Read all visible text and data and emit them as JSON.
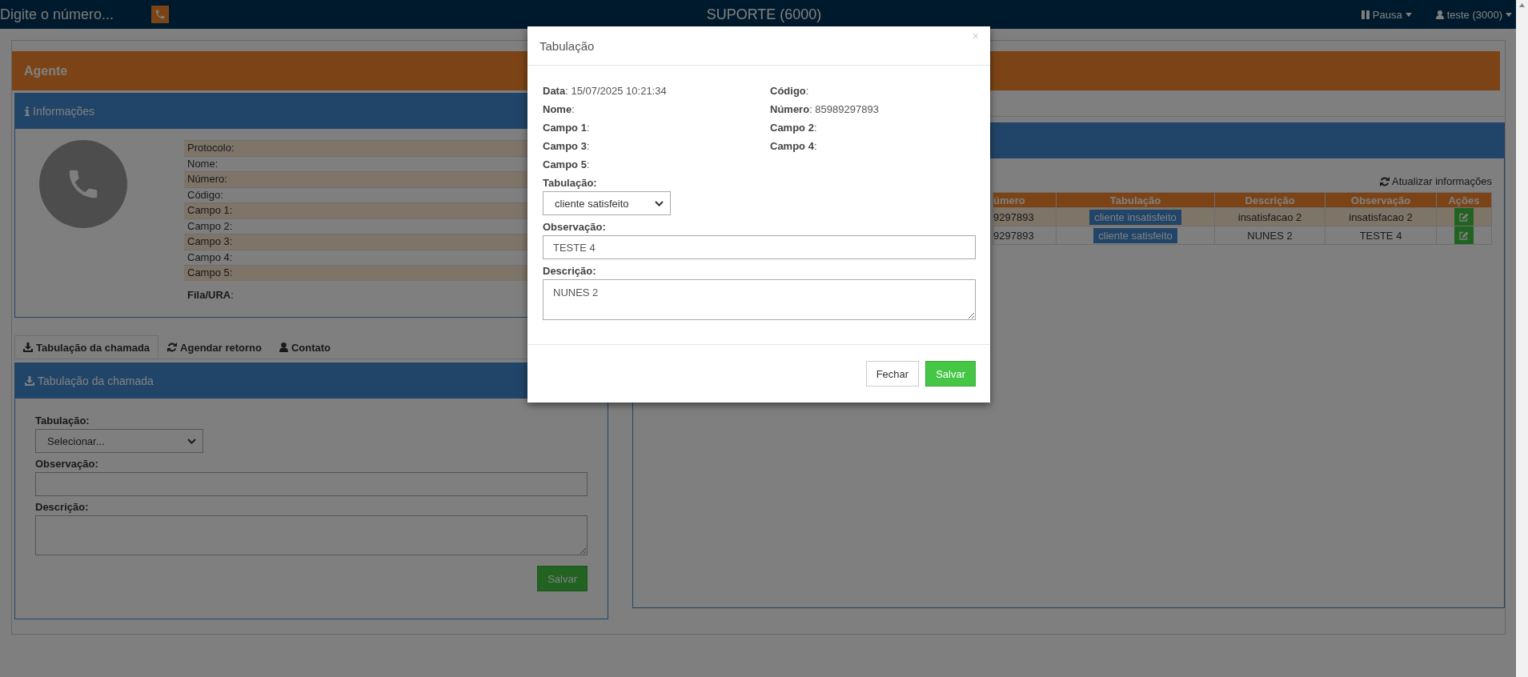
{
  "navbar": {
    "dial_placeholder": "Digite o número...",
    "title": "SUPORTE (6000)",
    "pause_menu": "Pausa",
    "user_menu": "teste (3000)"
  },
  "agent": {
    "title": "Agente"
  },
  "info": {
    "title": "Informações",
    "rows": [
      "Protocolo:",
      "Nome:",
      "Número:",
      "Código:",
      "Campo 1:",
      "Campo 2:",
      "Campo 3:",
      "Campo 4:",
      "Campo 5:"
    ],
    "queue": "**Fila/URA**:"
  },
  "tabs": [
    {
      "label": "Tabulação da chamada",
      "kind": "download",
      "selected": true
    },
    {
      "label": "Agendar retorno",
      "kind": "refresh",
      "selected": false
    },
    {
      "label": "Contato",
      "kind": "user",
      "selected": false
    }
  ],
  "call_form": {
    "title": "Tabulação da chamada",
    "tabulacao_label": "Tabulação:",
    "tabulacao_value": "Selecionar...",
    "observacao_label": "Observação:",
    "descricao_label": "Descrição:",
    "save": "Salvar"
  },
  "history": {
    "refresh": "Atualizar informações",
    "columns": [
      "úmero",
      "Tabulação",
      "Descrição",
      "Observação",
      "Ações"
    ],
    "rows": [
      {
        "numero": "9297893",
        "tabulacao": "cliente insatisfeito",
        "descricao": "insatisfacao 2",
        "observacao": "insatisfacao 2"
      },
      {
        "numero": "9297893",
        "tabulacao": "cliente satisfeito",
        "descricao": "NUNES 2",
        "observacao": "TESTE 4"
      }
    ]
  },
  "modal": {
    "title": "Tabulação",
    "close": "×",
    "fields": [
      "**Data**: 15/07/2025 10:21:34",
      "**Código**:",
      "**Nome**:",
      "**Número**: 85989297893",
      "**Campo 1**:",
      "**Campo 2**:",
      "**Campo 3**:",
      "**Campo 4**:",
      "**Campo 5**:"
    ],
    "tabulacao_label": "Tabulação:",
    "tabulacao_value": "cliente satisfeito",
    "observacao_label": "Observação:",
    "observacao_value": "TESTE 4",
    "descricao_label": "Descrição:",
    "descricao_value": "NUNES 2",
    "close_button": "Fechar",
    "save_button": "Salvar"
  }
}
